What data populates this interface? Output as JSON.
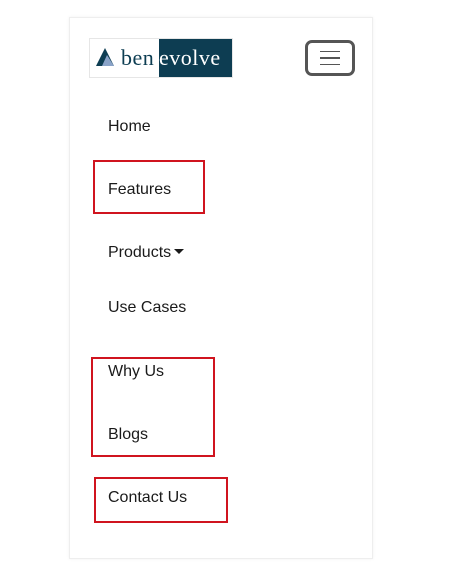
{
  "brand": {
    "text_left": "ben",
    "text_right": "evolve",
    "logo_mark": "mountain-triangle-icon",
    "color_dark": "#0d3d52",
    "color_mark_light": "#8aa3c8"
  },
  "toggler": {
    "icon": "hamburger-menu-icon"
  },
  "nav": {
    "items": [
      {
        "label": "Home"
      },
      {
        "label": "Features"
      },
      {
        "label": "Products"
      },
      {
        "label": "Use Cases"
      },
      {
        "label": "Why Us"
      },
      {
        "label": "Blogs"
      },
      {
        "label": "Contact Us"
      }
    ]
  },
  "highlight_color": "#d0141f"
}
